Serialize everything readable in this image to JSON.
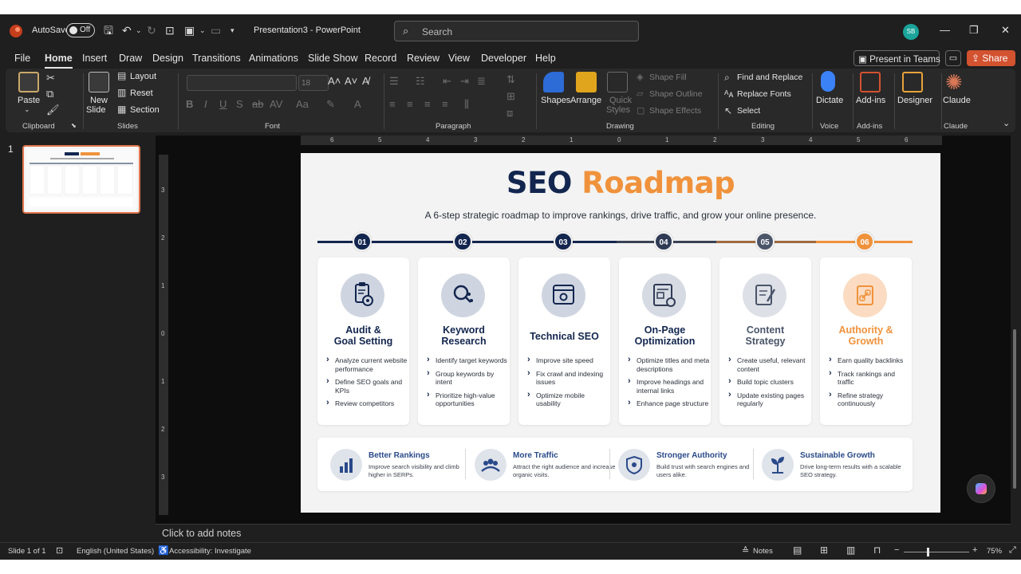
{
  "titlebar": {
    "autosave_label": "AutoSave",
    "toggle_state": "Off",
    "document_title": "Presentation3  -  PowerPoint",
    "search_placeholder": "Search",
    "user_initials": "SB"
  },
  "menu": {
    "tabs": [
      "File",
      "Home",
      "Insert",
      "Draw",
      "Design",
      "Transitions",
      "Animations",
      "Slide Show",
      "Record",
      "Review",
      "View",
      "Developer",
      "Help"
    ],
    "active_tab": "Home",
    "present_in_teams": "Present in Teams",
    "share": "Share"
  },
  "ribbon": {
    "clipboard": {
      "label": "Clipboard",
      "paste": "Paste"
    },
    "slides": {
      "label": "Slides",
      "new_slide_line1": "New",
      "new_slide_line2": "Slide",
      "layout": "Layout",
      "reset": "Reset",
      "section": "Section"
    },
    "font": {
      "label": "Font",
      "size": "18"
    },
    "paragraph": {
      "label": "Paragraph"
    },
    "drawing": {
      "label": "Drawing",
      "shapes": "Shapes",
      "arrange": "Arrange",
      "quick_styles_1": "Quick",
      "quick_styles_2": "Styles",
      "shape_fill": "Shape Fill",
      "shape_outline": "Shape Outline",
      "shape_effects": "Shape Effects"
    },
    "editing": {
      "label": "Editing",
      "find_replace": "Find and Replace",
      "replace_fonts": "Replace Fonts",
      "select": "Select"
    },
    "voice": {
      "label": "Voice",
      "dictate": "Dictate"
    },
    "addins": {
      "label": "Add-ins",
      "addins_button": "Add-ins"
    },
    "designer": {
      "label": "Designer"
    },
    "claude": {
      "label": "Claude",
      "button": "Claude"
    }
  },
  "thumbnails": [
    {
      "number": "1"
    }
  ],
  "slide": {
    "title_part1": "SEO",
    "title_part2": "Roadmap",
    "subtitle": "A 6-step strategic roadmap to improve rankings, drive traffic, and grow your online presence.",
    "steps": [
      {
        "num": "01",
        "title_line1": "Audit &",
        "title_line2": "Goal Setting",
        "color": "#13264f",
        "items": [
          "Analyze current website performance",
          "Define SEO goals and KPIs",
          "Review competitors"
        ]
      },
      {
        "num": "02",
        "title_line1": "Keyword",
        "title_line2": "Research",
        "color": "#13264f",
        "items": [
          "Identify target keywords",
          "Group keywords by intent",
          "Prioritize high-value opportunities"
        ]
      },
      {
        "num": "03",
        "title_line1": "Technical SEO",
        "title_line2": "",
        "color": "#13264f",
        "items": [
          "Improve site speed",
          "Fix crawl and indexing issues",
          "Optimize mobile usability"
        ]
      },
      {
        "num": "04",
        "title_line1": "On-Page",
        "title_line2": "Optimization",
        "color": "#2f3b55",
        "items": [
          "Optimize titles and meta descriptions",
          "Improve headings and internal links",
          "Enhance page structure"
        ]
      },
      {
        "num": "05",
        "title_line1": "Content",
        "title_line2": "Strategy",
        "color": "#4a5569",
        "items": [
          "Create useful, relevant content",
          "Build topic clusters",
          "Update existing pages regularly"
        ]
      },
      {
        "num": "06",
        "title_line1": "Authority &",
        "title_line2": "Growth",
        "color": "#f0923c",
        "items": [
          "Earn quality backlinks",
          "Track rankings and traffic",
          "Refine strategy continuously"
        ]
      }
    ],
    "benefits": [
      {
        "title": "Better Rankings",
        "desc": "Improve search visibility and climb higher in SERPs.",
        "icon": "bar-chart-icon"
      },
      {
        "title": "More Traffic",
        "desc": "Attract the right audience and increase organic visits.",
        "icon": "people-icon"
      },
      {
        "title": "Stronger Authority",
        "desc": "Build trust with search engines and users alike.",
        "icon": "shield-icon"
      },
      {
        "title": "Sustainable Growth",
        "desc": "Drive long-term results with a scalable SEO strategy.",
        "icon": "sprout-icon"
      }
    ]
  },
  "notes_placeholder": "Click to add notes",
  "status": {
    "slide_counter": "Slide 1 of 1",
    "language": "English (United States)",
    "accessibility": "Accessibility: Investigate",
    "notes": "Notes",
    "zoom": "75%"
  },
  "colors": {
    "accent_orange": "#f0923c",
    "navy": "#13264f",
    "powerpoint_red": "#d35230"
  }
}
